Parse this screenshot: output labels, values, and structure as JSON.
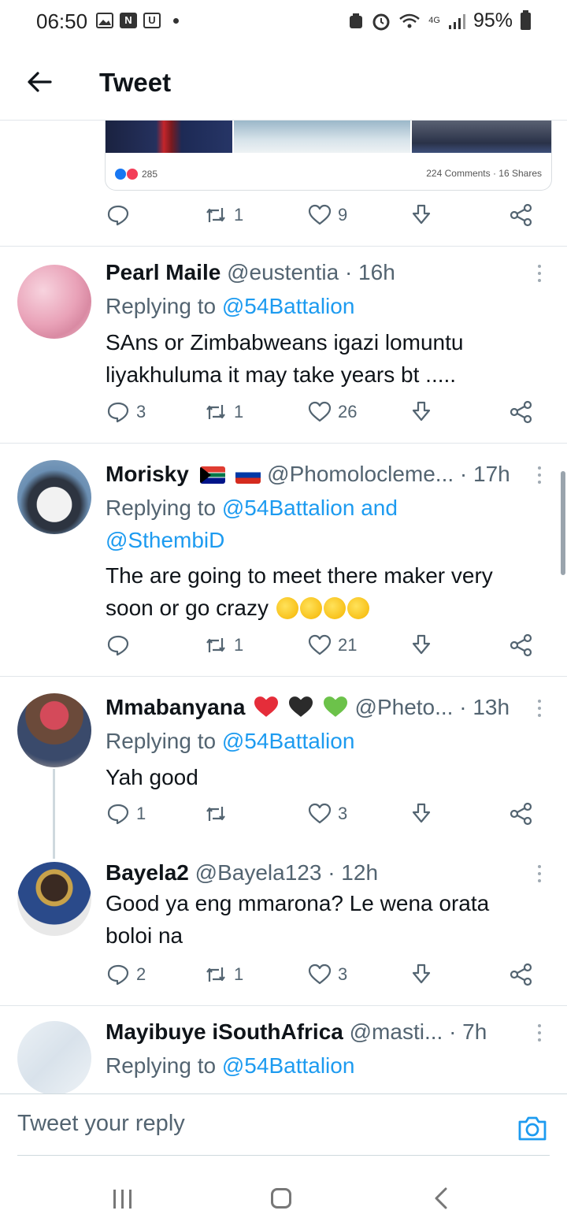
{
  "status_bar": {
    "time": "06:50",
    "battery": "95%",
    "network": "4G",
    "notif_n": "N",
    "notif_u": "U"
  },
  "header": {
    "title": "Tweet"
  },
  "embedded_card": {
    "reactions_count": "285",
    "comments_shares": "224 Comments · 16 Shares"
  },
  "main_actions": {
    "retweets": "1",
    "likes": "9"
  },
  "tweets": [
    {
      "name": "Pearl Maile",
      "handle": "@eustentia",
      "time": "· 16h",
      "replying_prefix": "Replying to",
      "replying_to": "@54Battalion",
      "text_line1": "SAns or Zimbabweans igazi lomuntu",
      "text_line2": "liyakhuluma it may take years bt .....",
      "replies": "3",
      "retweets": "1",
      "likes": "26"
    },
    {
      "name": "Morisky",
      "handle": "@Phomolocleme...",
      "time": "· 17h",
      "replying_prefix": "Replying to",
      "replying_to": "@54Battalion and",
      "replying_to2": "@SthembiD",
      "text_line1": "The are  going to meet there maker very",
      "text_line2": "soon or go crazy",
      "replies": "",
      "retweets": "1",
      "likes": "21"
    },
    {
      "name": "Mmabanyana",
      "handle": "@Pheto...",
      "time": "· 13h",
      "replying_prefix": "Replying to",
      "replying_to": "@54Battalion",
      "text_line1": "Yah good",
      "replies": "1",
      "retweets": "",
      "likes": "3"
    },
    {
      "name": "Bayela2",
      "handle": "@Bayela123",
      "time": "· 12h",
      "text_line1": "Good ya eng mmarona? Le wena orata",
      "text_line2": "boloi na",
      "replies": "2",
      "retweets": "1",
      "likes": "3"
    },
    {
      "name": "Mayibuye iSouthAfrica",
      "handle": "@masti...",
      "time": "· 7h",
      "replying_prefix": "Replying to",
      "replying_to": "@54Battalion"
    }
  ],
  "composer": {
    "placeholder": "Tweet your reply"
  },
  "icons": {
    "back": "arrow-left-icon",
    "reply": "reply-icon",
    "retweet": "retweet-icon",
    "like": "heart-icon",
    "download": "download-icon",
    "share": "share-icon",
    "camera": "camera-icon",
    "more": "more-vertical-icon"
  },
  "colors": {
    "accent": "#1d9bf0",
    "text": "#0f1419",
    "muted": "#536471"
  }
}
